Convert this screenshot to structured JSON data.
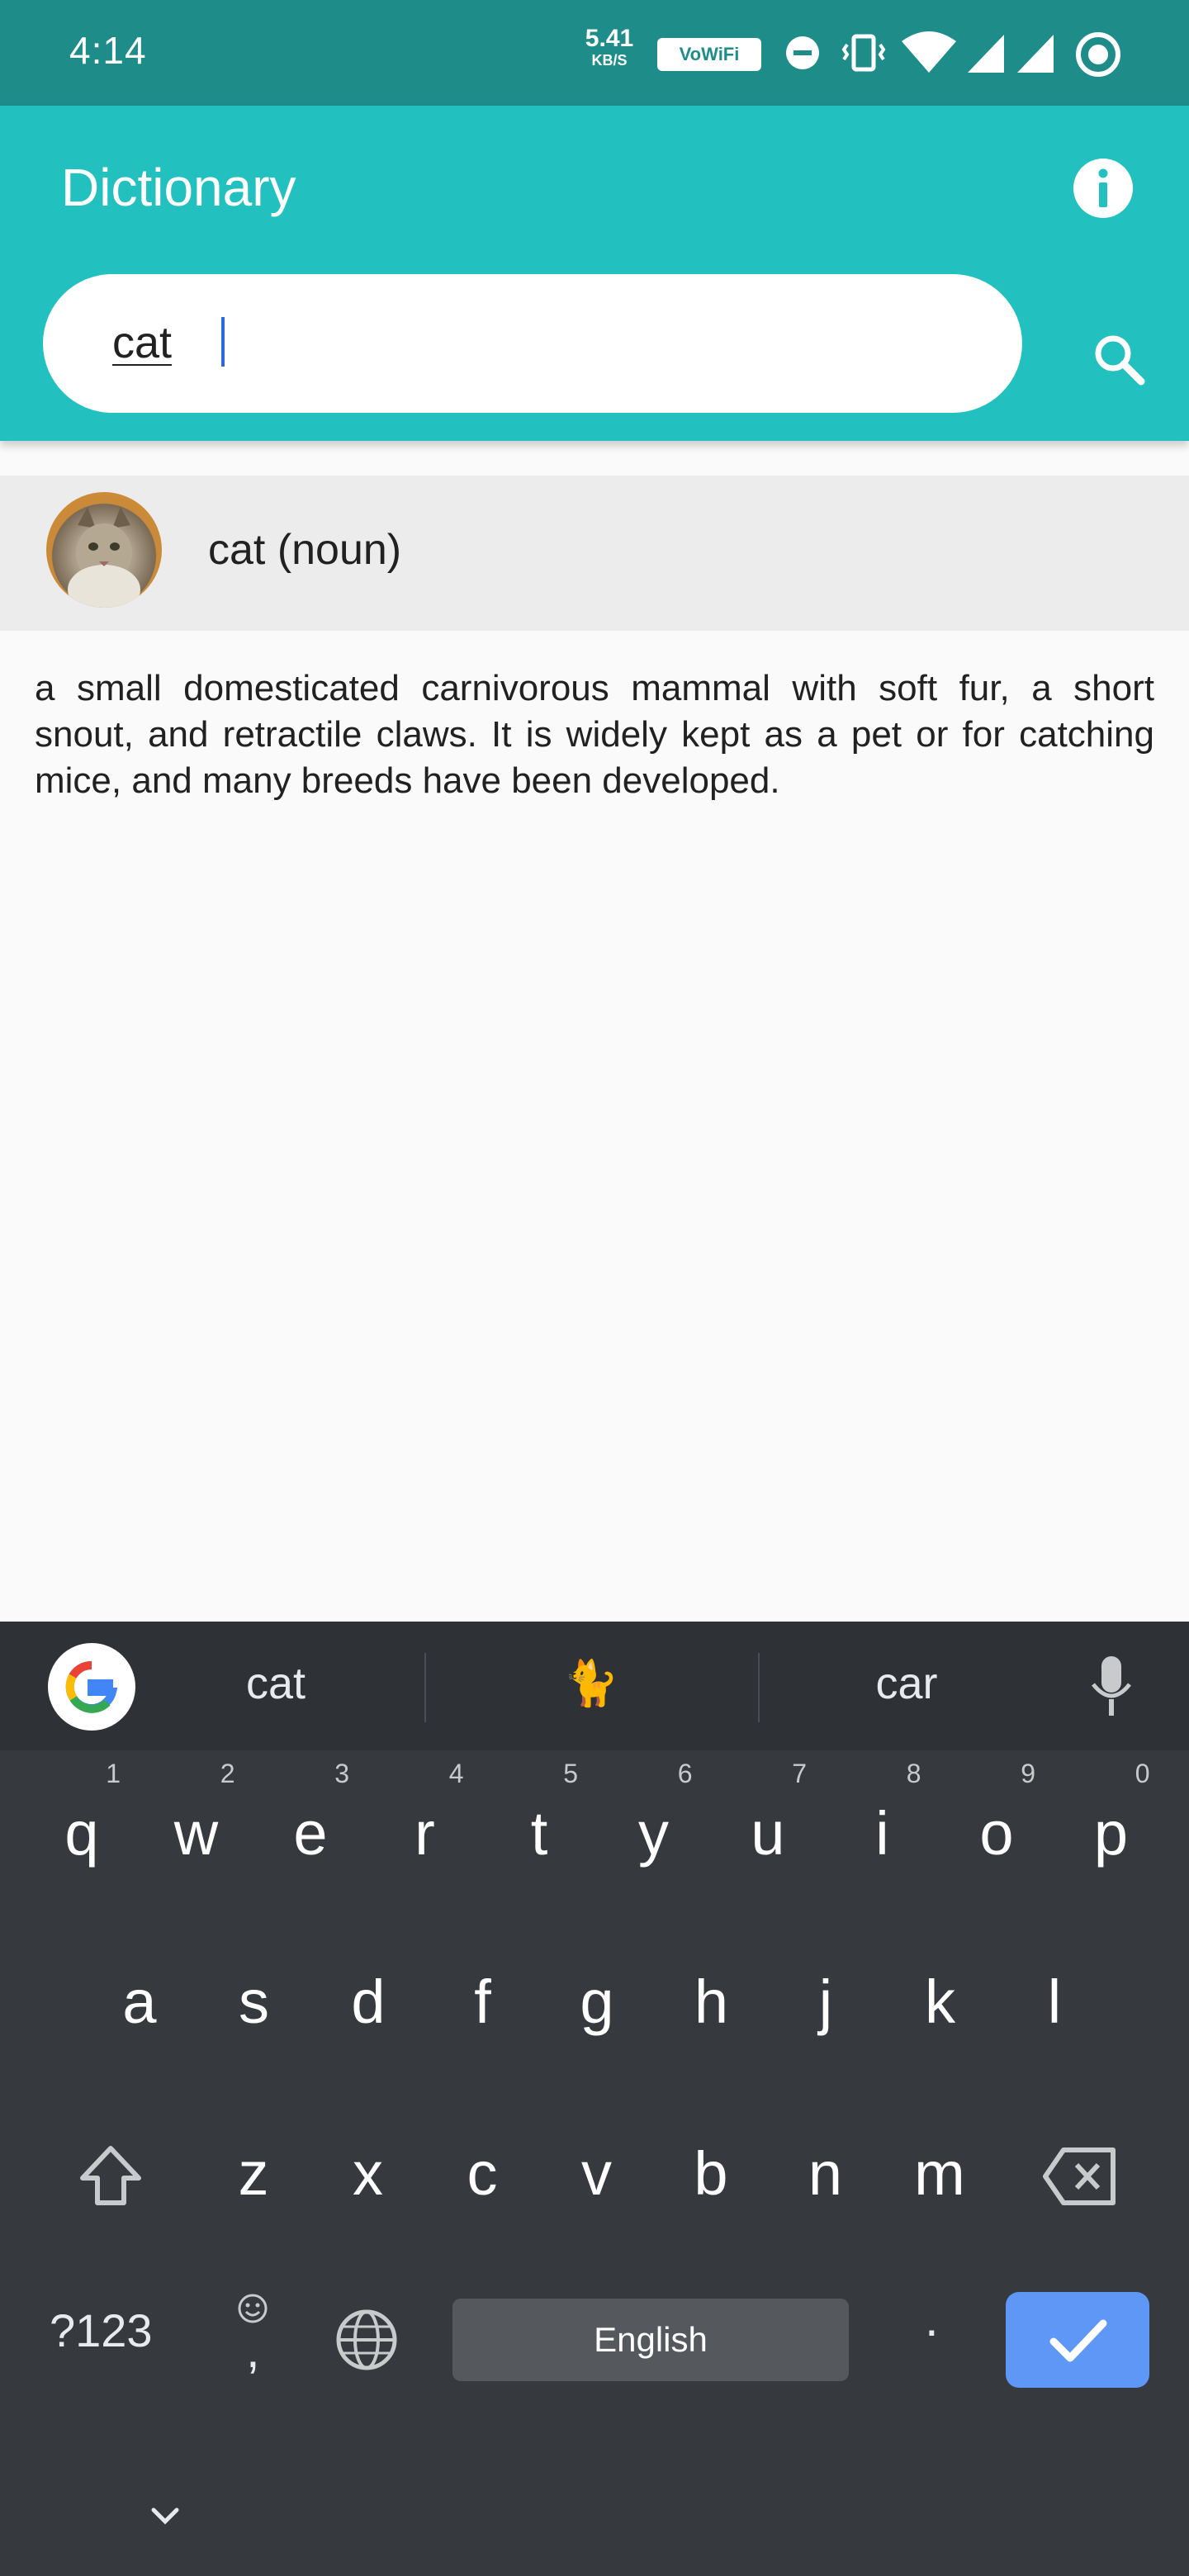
{
  "status_bar": {
    "time": "4:14",
    "net_speed_value": "5.41",
    "net_speed_unit": "KB/S",
    "vowifi_label": "VoWiFi",
    "icons": [
      "dnd-icon",
      "vibrate-icon",
      "wifi-icon",
      "signal-icon",
      "signal-icon",
      "sync-icon"
    ]
  },
  "app_bar": {
    "title": "Dictionary",
    "info_icon": "info-icon",
    "search_icon": "search-icon",
    "color": "#22c0bf"
  },
  "search": {
    "value": "cat"
  },
  "result": {
    "term": "cat (noun)",
    "definition": "a small domesticated carnivorous mammal with soft fur, a short snout, and retractile claws. It is widely kept as a pet or for catching mice, and many breeds have been developed."
  },
  "keyboard": {
    "suggestions": [
      "cat",
      "🐈",
      "car"
    ],
    "rows": [
      [
        {
          "k": "q",
          "h": "1"
        },
        {
          "k": "w",
          "h": "2"
        },
        {
          "k": "e",
          "h": "3"
        },
        {
          "k": "r",
          "h": "4"
        },
        {
          "k": "t",
          "h": "5"
        },
        {
          "k": "y",
          "h": "6"
        },
        {
          "k": "u",
          "h": "7"
        },
        {
          "k": "i",
          "h": "8"
        },
        {
          "k": "o",
          "h": "9"
        },
        {
          "k": "p",
          "h": "0"
        }
      ],
      [
        {
          "k": "a"
        },
        {
          "k": "s"
        },
        {
          "k": "d"
        },
        {
          "k": "f"
        },
        {
          "k": "g"
        },
        {
          "k": "h"
        },
        {
          "k": "j"
        },
        {
          "k": "k"
        },
        {
          "k": "l"
        }
      ],
      [
        {
          "k": "z"
        },
        {
          "k": "x"
        },
        {
          "k": "c"
        },
        {
          "k": "v"
        },
        {
          "k": "b"
        },
        {
          "k": "n"
        },
        {
          "k": "m"
        }
      ]
    ],
    "symbols_label": "?123",
    "comma_label": ",",
    "period_label": ".",
    "space_label": "English",
    "enter_color": "#5e97f6"
  }
}
